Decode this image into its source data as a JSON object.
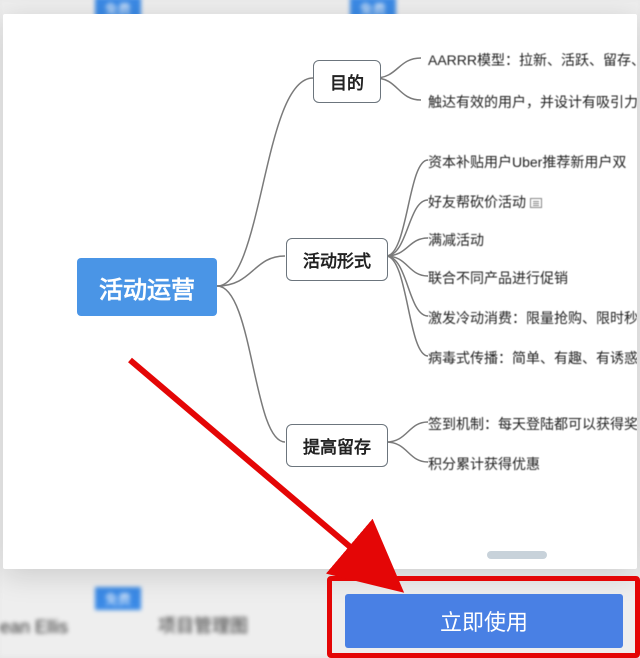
{
  "background": {
    "free_tag": "免费",
    "text_left": "ean Ellis",
    "text_center": "项目管理图"
  },
  "modal": {
    "root": "活动运营",
    "children": [
      {
        "label": "目的",
        "leaves": [
          "AARRR模型：拉新、活跃、留存、收入",
          "触达有效的用户，并设计有吸引力的转"
        ]
      },
      {
        "label": "活动形式",
        "leaves": [
          "资本补贴用户Uber推荐新用户双",
          "好友帮砍价活动",
          "满减活动",
          "联合不同产品进行促销",
          "激发冷动消费：限量抢购、限时秒",
          "病毒式传播：简单、有趣、有诱惑"
        ]
      },
      {
        "label": "提高留存",
        "leaves": [
          "签到机制：每天登陆都可以获得奖",
          "积分累计获得优惠"
        ]
      }
    ]
  },
  "cta": {
    "use_now": "立即使用"
  }
}
